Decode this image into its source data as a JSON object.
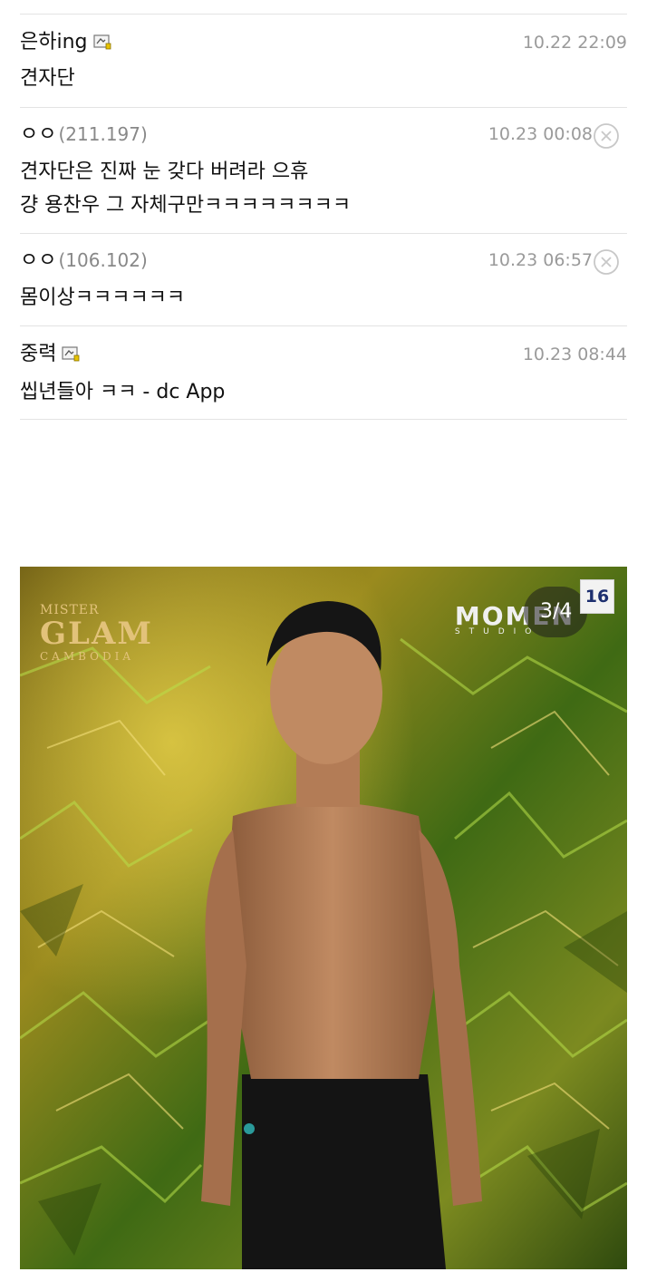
{
  "comments": [
    {
      "nickname": "은하ing",
      "ip": "",
      "date": "10.22 22:09",
      "lines": [
        "견자단"
      ],
      "deletable": false
    },
    {
      "nickname": "ㅇㅇ",
      "ip": "(211.197)",
      "date": "10.23 00:08",
      "lines": [
        "견자단은 진짜 눈 갖다 버려라 으휴",
        "걍 용찬우 그 자체구만ㅋㅋㅋㅋㅋㅋㅋㅋ"
      ],
      "deletable": true
    },
    {
      "nickname": "ㅇㅇ",
      "ip": "(106.102)",
      "date": "10.23 06:57",
      "lines": [
        "몸이상ㅋㅋㅋㅋㅋㅋ"
      ],
      "deletable": true
    },
    {
      "nickname": "중력",
      "ip": "",
      "date": "10.23 08:44",
      "lines": [
        "씹년들아 ㅋㅋ - dc App"
      ],
      "deletable": false
    }
  ],
  "photo": {
    "brand_left": {
      "line1": "MISTER",
      "line2": "GLAM",
      "line3": "CAMBODIA"
    },
    "brand_right": {
      "line1": "MOMEN",
      "line2": "STUDIO"
    },
    "pager": "3/4",
    "counter": "16"
  },
  "icons": {
    "nick_badge": "gallery-member-icon",
    "delete": "delete-circle-x-icon"
  },
  "colors": {
    "divider": "#e3e3e3",
    "date": "#9a9a9a",
    "ip": "#888888",
    "counter_text": "#1d2f6f"
  }
}
